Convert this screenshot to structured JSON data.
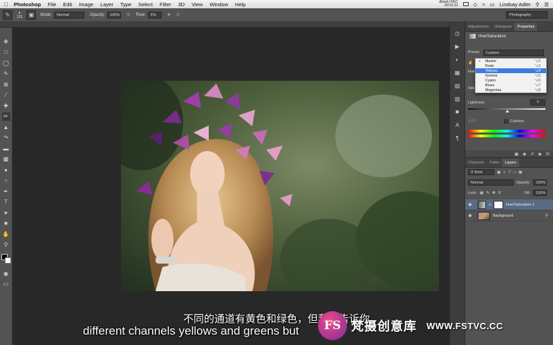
{
  "menubar": {
    "app": "Photoshop",
    "items": [
      "File",
      "Edit",
      "Image",
      "Layer",
      "Type",
      "Select",
      "Filter",
      "3D",
      "View",
      "Window",
      "Help"
    ],
    "recording_name": "dbowU REC",
    "recording_time": "00:01:31",
    "user": "Lindsay Adler"
  },
  "optbar": {
    "brush_size": "125",
    "mode_label": "Mode:",
    "mode_value": "Normal",
    "opacity_label": "Opacity:",
    "opacity_value": "100%",
    "flow_label": "Flow:",
    "flow_value": "6%",
    "workspace": "Photography"
  },
  "properties": {
    "tabs": [
      "Adjustments",
      "Histogram",
      "Properties"
    ],
    "active_tab": "Properties",
    "title": "Hue/Saturation",
    "preset_label": "Preset:",
    "preset_value": "Custom",
    "hue_label": "Hue",
    "sat_label": "Satur",
    "channels": [
      {
        "label": "Master",
        "shortcut": "⌥2",
        "checked": true
      },
      {
        "label": "Reds",
        "shortcut": "⌥3"
      },
      {
        "label": "Yellows",
        "shortcut": "⌥4",
        "highlighted": true
      },
      {
        "label": "Greens",
        "shortcut": "⌥5"
      },
      {
        "label": "Cyans",
        "shortcut": "⌥6"
      },
      {
        "label": "Blues",
        "shortcut": "⌥7"
      },
      {
        "label": "Magentas",
        "shortcut": "⌥8"
      }
    ],
    "lightness_label": "Lightness:",
    "lightness_value": "0",
    "colorize_label": "Colorize"
  },
  "layers": {
    "tabs": [
      "Channels",
      "Paths",
      "Layers"
    ],
    "active_tab": "Layers",
    "kind_label": "Kind",
    "blend_mode": "Normal",
    "opacity_label": "Opacity:",
    "opacity_value": "100%",
    "lock_label": "Lock:",
    "fill_label": "Fill:",
    "fill_value": "100%",
    "items": [
      {
        "name": "Hue/Saturation 1"
      },
      {
        "name": "Background"
      }
    ]
  },
  "subtitles": {
    "chinese": "不同的通道有黄色和绿色，但我要告诉你",
    "english": "different channels yellows and greens but"
  },
  "watermark": {
    "logo": "FS",
    "name": "梵摄创意库",
    "url": "WWW.FSTVC.CC"
  }
}
